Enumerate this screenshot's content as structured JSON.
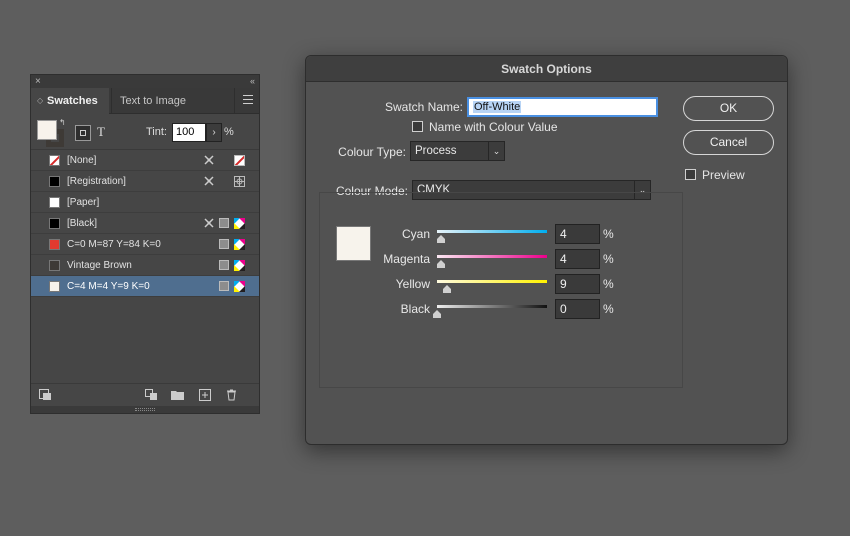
{
  "panel": {
    "close": "×",
    "collapse": "‹‹",
    "tabs": [
      "Swatches",
      "Text to Image"
    ],
    "tint_label": "Tint:",
    "tint_value": "100",
    "tint_pct": "%",
    "text_icon": "T",
    "swatches": [
      {
        "name": "[None]",
        "color": "none",
        "no_edit": true,
        "type": "none"
      },
      {
        "name": "[Registration]",
        "color": "#000000",
        "no_edit": true,
        "type": "registration"
      },
      {
        "name": "[Paper]",
        "color": "#ffffff",
        "no_edit": false,
        "type": ""
      },
      {
        "name": "[Black]",
        "color": "#000000",
        "no_edit": true,
        "type": "process"
      },
      {
        "name": "C=0 M=87 Y=84 K=0",
        "color": "#e23a2f",
        "no_edit": false,
        "type": "process"
      },
      {
        "name": "Vintage Brown",
        "color": "#3e3a36",
        "no_edit": false,
        "type": "process"
      },
      {
        "name": "C=4 M=4 Y=9 K=0",
        "color": "#f7f3ec",
        "no_edit": false,
        "type": "process",
        "selected": true
      }
    ]
  },
  "dialog": {
    "title": "Swatch Options",
    "swatch_name_label": "Swatch Name:",
    "swatch_name_value": "Off-White",
    "name_with_value_label": "Name with Colour Value",
    "colour_type_label": "Colour Type:",
    "colour_type_value": "Process",
    "colour_mode_label": "Colour Mode:",
    "colour_mode_value": "CMYK",
    "ok": "OK",
    "cancel": "Cancel",
    "preview": "Preview",
    "preview_color": "#f7f3ec",
    "sliders": [
      {
        "label": "Cyan",
        "value": "4",
        "fraction": 0.04
      },
      {
        "label": "Magenta",
        "value": "4",
        "fraction": 0.04
      },
      {
        "label": "Yellow",
        "value": "9",
        "fraction": 0.09
      },
      {
        "label": "Black",
        "value": "0",
        "fraction": 0.0
      }
    ],
    "pct": "%"
  }
}
